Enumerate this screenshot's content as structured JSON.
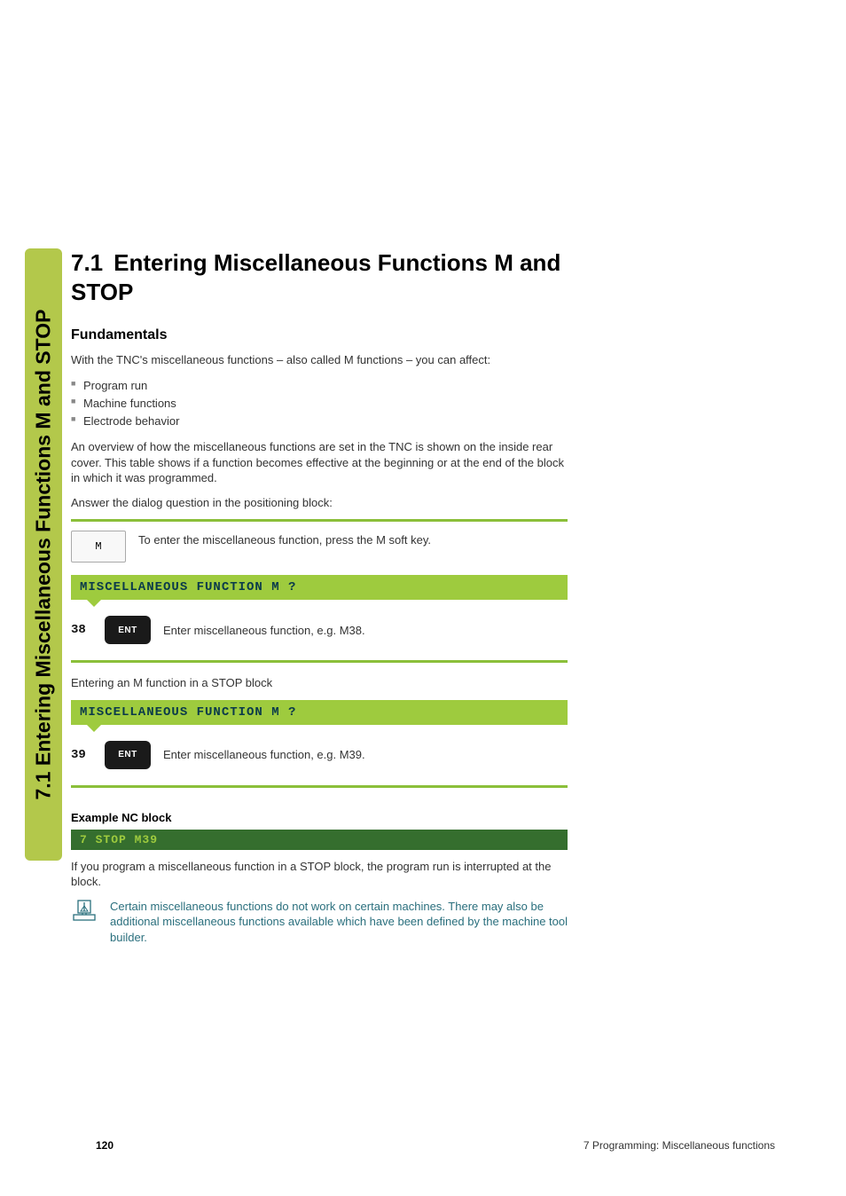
{
  "sideTab": "7.1 Entering Miscellaneous Functions M and STOP",
  "section": {
    "number": "7.1",
    "title": "Entering Miscellaneous Functions M and STOP"
  },
  "fundamentals": {
    "heading": "Fundamentals",
    "intro": "With the TNC's miscellaneous functions – also called M functions – you can affect:",
    "bullets": [
      "Program run",
      "Machine functions",
      "Electrode behavior"
    ],
    "overview": "An overview of how the miscellaneous functions are set in the TNC is shown on the inside rear cover. This table shows if a function becomes effective at the beginning or at the end of the block in which it was programmed.",
    "prompt": "Answer the dialog question in the positioning block:"
  },
  "mKey": {
    "label": "M",
    "text": "To enter the miscellaneous function, press the M soft key."
  },
  "callout1": {
    "label": "MISCELLANEOUS FUNCTION M ?"
  },
  "ent1": {
    "num": "38",
    "key": "ENT",
    "text": "Enter miscellaneous function, e.g. M38."
  },
  "stopIntro": "Entering an M function in a STOP block",
  "callout2": {
    "label": "MISCELLANEOUS FUNCTION M ?"
  },
  "ent2": {
    "num": "39",
    "key": "ENT",
    "text": "Enter miscellaneous function, e.g. M39."
  },
  "example": {
    "heading": "Example NC block",
    "code": "7  STOP M39"
  },
  "afterExample": "If you program a miscellaneous function in a STOP block, the program run is interrupted at the block.",
  "note": "Certain miscellaneous functions do not work on certain machines. There may also be additional miscellaneous functions available which have been defined by the machine tool builder.",
  "footer": {
    "page": "120",
    "chapter": "7 Programming: Miscellaneous functions"
  }
}
